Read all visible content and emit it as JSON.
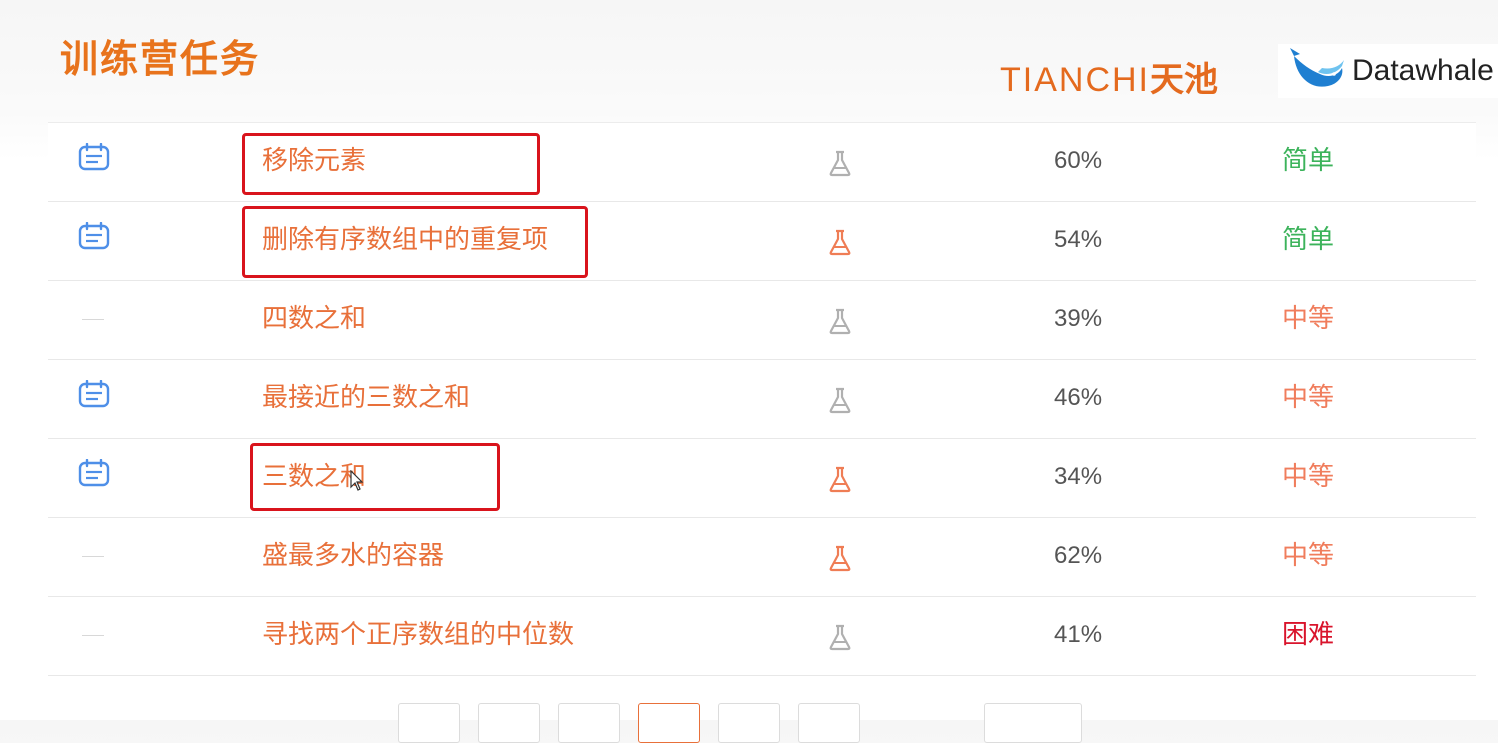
{
  "header": {
    "title": "训练营任务",
    "tianchi_logo_latin": "TIANCHI",
    "tianchi_logo_cn": "天池",
    "datawhale_logo": "Datawhale"
  },
  "colors": {
    "accent": "#e8731c",
    "title_link": "#e8703a",
    "easy": "#3cb35b",
    "medium": "#f07d5c",
    "hard": "#d9142c",
    "highlight_box": "#d9141c"
  },
  "problems": [
    {
      "status_icon": "note-icon",
      "title": "移除元素",
      "flask_color": "#b0b0b0",
      "pass_rate": "60%",
      "difficulty": "简单",
      "difficulty_color": "#3cb35b"
    },
    {
      "status_icon": "note-icon",
      "title": "删除有序数组中的重复项",
      "flask_color": "#ef7d55",
      "pass_rate": "54%",
      "difficulty": "简单",
      "difficulty_color": "#3cb35b"
    },
    {
      "status_icon": "dash",
      "title": "四数之和",
      "flask_color": "#b0b0b0",
      "pass_rate": "39%",
      "difficulty": "中等",
      "difficulty_color": "#f07d5c"
    },
    {
      "status_icon": "note-icon",
      "title": "最接近的三数之和",
      "flask_color": "#b0b0b0",
      "pass_rate": "46%",
      "difficulty": "中等",
      "difficulty_color": "#f07d5c"
    },
    {
      "status_icon": "note-icon",
      "title": "三数之和",
      "flask_color": "#ef7d55",
      "pass_rate": "34%",
      "difficulty": "中等",
      "difficulty_color": "#f07d5c"
    },
    {
      "status_icon": "dash",
      "title": "盛最多水的容器",
      "flask_color": "#ef7d55",
      "pass_rate": "62%",
      "difficulty": "中等",
      "difficulty_color": "#f07d5c"
    },
    {
      "status_icon": "dash",
      "title": "寻找两个正序数组的中位数",
      "flask_color": "#b0b0b0",
      "pass_rate": "41%",
      "difficulty": "困难",
      "difficulty_color": "#d9142c"
    }
  ],
  "highlighted_rows": [
    "移除元素",
    "删除有序数组中的重复项",
    "三数之和"
  ],
  "pagination": {
    "active_index": 3,
    "button_count": 7
  }
}
